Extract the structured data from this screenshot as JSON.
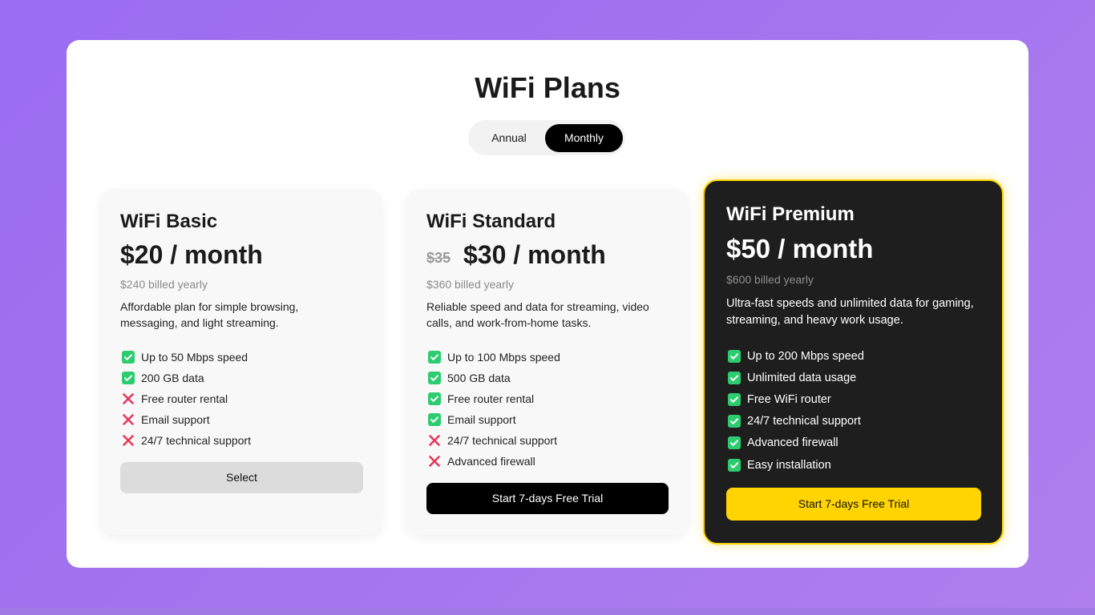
{
  "page": {
    "title": "WiFi Plans"
  },
  "toggle": {
    "annual": "Annual",
    "monthly": "Monthly",
    "selected": "Monthly"
  },
  "colors": {
    "accent": "#ffd400",
    "check": "#2ecc71",
    "cross": "#e8365b",
    "dark_card": "#1e1e1e"
  },
  "plans": [
    {
      "name": "WiFi Basic",
      "price": "$20 / month",
      "old_price": "",
      "billed": "$240 billed yearly",
      "description": "Affordable plan for simple browsing, messaging, and light streaming.",
      "features": [
        {
          "text": "Up to 50 Mbps speed",
          "included": true,
          "icon": "check-icon"
        },
        {
          "text": "200 GB data",
          "included": true,
          "icon": "check-icon"
        },
        {
          "text": "Free router rental",
          "included": false,
          "icon": "cross-icon"
        },
        {
          "text": "Email support",
          "included": false,
          "icon": "cross-icon"
        },
        {
          "text": "24/7 technical support",
          "included": false,
          "icon": "cross-icon"
        }
      ],
      "cta": "Select"
    },
    {
      "name": "WiFi Standard",
      "price": "$30 / month",
      "old_price": "$35",
      "billed": "$360 billed yearly",
      "description": "Reliable speed and data for streaming, video calls, and work-from-home tasks.",
      "features": [
        {
          "text": "Up to 100 Mbps speed",
          "included": true,
          "icon": "check-icon"
        },
        {
          "text": "500 GB data",
          "included": true,
          "icon": "check-icon"
        },
        {
          "text": "Free router rental",
          "included": true,
          "icon": "check-icon"
        },
        {
          "text": "Email support",
          "included": true,
          "icon": "check-icon"
        },
        {
          "text": "24/7 technical support",
          "included": false,
          "icon": "cross-icon"
        },
        {
          "text": "Advanced firewall",
          "included": false,
          "icon": "cross-icon"
        }
      ],
      "cta": "Start 7-days Free Trial"
    },
    {
      "name": "WiFi Premium",
      "price": "$50 / month",
      "old_price": "",
      "billed": "$600 billed yearly",
      "description": "Ultra-fast speeds and unlimited data for gaming, streaming, and heavy work usage.",
      "features": [
        {
          "text": "Up to 200 Mbps speed",
          "included": true,
          "icon": "check-icon"
        },
        {
          "text": "Unlimited data usage",
          "included": true,
          "icon": "check-icon"
        },
        {
          "text": "Free WiFi router",
          "included": true,
          "icon": "check-icon"
        },
        {
          "text": "24/7 technical support",
          "included": true,
          "icon": "check-icon"
        },
        {
          "text": "Advanced firewall",
          "included": true,
          "icon": "check-icon"
        },
        {
          "text": "Easy installation",
          "included": true,
          "icon": "check-icon"
        }
      ],
      "cta": "Start 7-days Free Trial"
    }
  ]
}
